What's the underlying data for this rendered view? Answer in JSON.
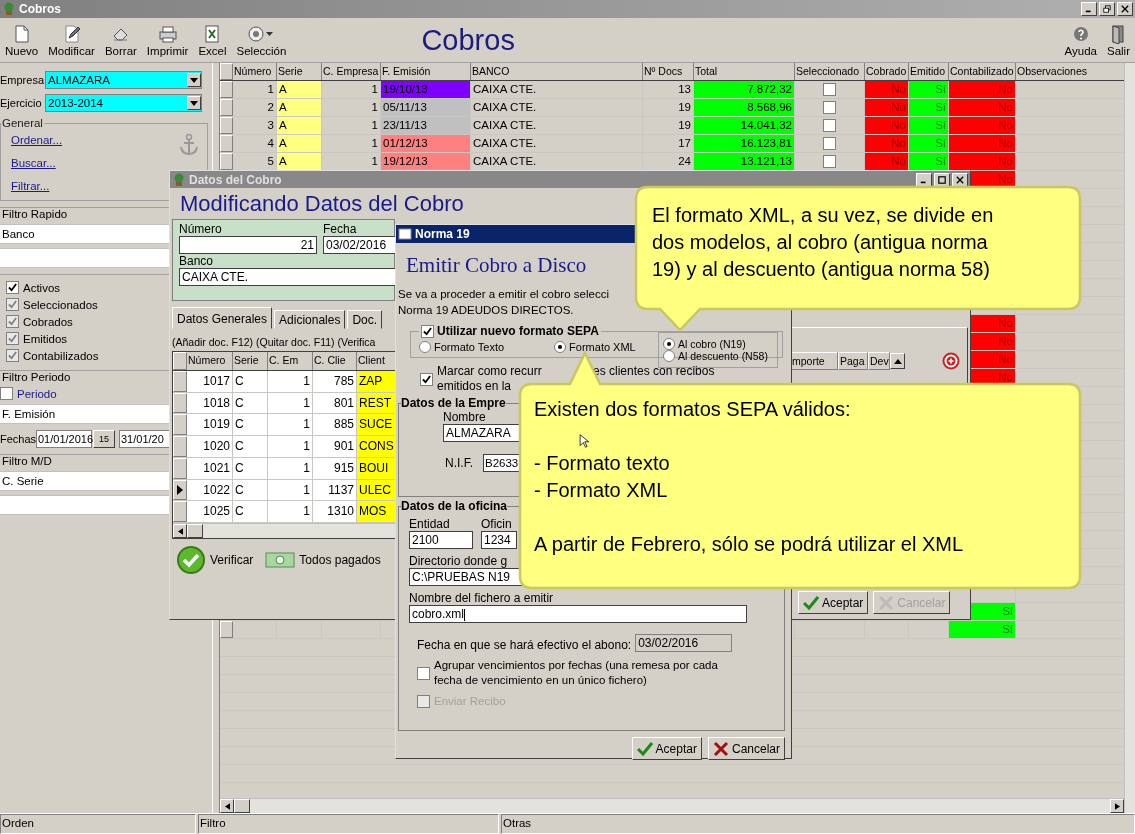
{
  "window": {
    "title": "Cobros"
  },
  "toolbar": {
    "buttons": [
      {
        "label": "Nuevo",
        "kind": "new"
      },
      {
        "label": "Modificar",
        "kind": "edit"
      },
      {
        "label": "Borrar",
        "kind": "delete"
      },
      {
        "label": "Imprimir",
        "kind": "print"
      },
      {
        "label": "Excel",
        "kind": "excel"
      },
      {
        "label": "Selección",
        "kind": "select"
      }
    ],
    "title": "Cobros",
    "right_buttons": [
      {
        "label": "Ayuda",
        "kind": "help"
      },
      {
        "label": "Salir",
        "kind": "exit"
      }
    ]
  },
  "sidebar": {
    "empresa": {
      "label": "Empresa",
      "value": "ALMAZARA"
    },
    "ejercicio": {
      "label": "Ejercicio",
      "value": "2013-2014"
    },
    "general": {
      "title": "General",
      "links": [
        "Ordenar...",
        "Buscar...",
        "Filtrar..."
      ]
    },
    "filtro_rapido": {
      "title": "Filtro Rapido",
      "field": "Banco"
    },
    "checks": [
      {
        "label": "Activos",
        "checked": true,
        "disabled": false
      },
      {
        "label": "Seleccionados",
        "checked": true,
        "disabled": true
      },
      {
        "label": "Cobrados",
        "checked": true,
        "disabled": true
      },
      {
        "label": "Emitidos",
        "checked": true,
        "disabled": true
      },
      {
        "label": "Contabilizados",
        "checked": true,
        "disabled": true
      }
    ],
    "filtro_periodo": {
      "title": "Filtro Periodo",
      "periodo": {
        "label": "Periodo",
        "checked": false
      },
      "field": "F. Emisión",
      "fechas_label": "Fechas",
      "from": "01/01/2016",
      "calendar": "15",
      "to": "31/01/20"
    },
    "filtro_md": {
      "title": "Filtro M/D",
      "field": "C. Serie"
    }
  },
  "table": {
    "columns": [
      "Número",
      "Serie",
      "C. Empresa",
      "F. Emisión",
      "BANCO",
      "Nº Docs",
      "Total",
      "Seleccionado",
      "Cobrado",
      "Emitido",
      "Contabilizado",
      "Observaciones"
    ],
    "rows": [
      {
        "numero": "1",
        "serie": "A",
        "empresa": "1",
        "fecha": "19/10/13",
        "color": "#8000ff",
        "banco": "CAIXA CTE.",
        "docs": "13",
        "total": "7.872,32",
        "seleccionado": false,
        "cobrado": {
          "text": "No",
          "on": false
        },
        "emitido": {
          "text": "Sí",
          "on": true
        },
        "contabilizado": {
          "text": "No",
          "on": false
        }
      },
      {
        "numero": "2",
        "serie": "A",
        "empresa": "1",
        "fecha": "05/11/13",
        "color": "#c0c0c0",
        "banco": "CAIXA CTE.",
        "docs": "19",
        "total": "8.568,96",
        "seleccionado": false,
        "cobrado": {
          "text": "No",
          "on": false
        },
        "emitido": {
          "text": "Sí",
          "on": true
        },
        "contabilizado": {
          "text": "No",
          "on": false
        }
      },
      {
        "numero": "3",
        "serie": "A",
        "empresa": "1",
        "fecha": "23/11/13",
        "color": "#c0c0c0",
        "banco": "CAIXA CTE.",
        "docs": "19",
        "total": "14.041,32",
        "seleccionado": false,
        "cobrado": {
          "text": "No",
          "on": false
        },
        "emitido": {
          "text": "Sí",
          "on": true
        },
        "contabilizado": {
          "text": "No",
          "on": false
        }
      },
      {
        "numero": "4",
        "serie": "A",
        "empresa": "1",
        "fecha": "01/12/13",
        "color": "#ff8080",
        "banco": "CAIXA CTE.",
        "docs": "17",
        "total": "16.123,81",
        "seleccionado": false,
        "cobrado": {
          "text": "No",
          "on": false
        },
        "emitido": {
          "text": "Sí",
          "on": true
        },
        "contabilizado": {
          "text": "No",
          "on": false
        }
      },
      {
        "numero": "5",
        "serie": "A",
        "empresa": "1",
        "fecha": "19/12/13",
        "color": "#ff8080",
        "banco": "CAIXA CTE.",
        "docs": "24",
        "total": "13.121,13",
        "seleccionado": false,
        "cobrado": {
          "text": "No",
          "on": false
        },
        "emitido": {
          "text": "Sí",
          "on": true
        },
        "contabilizado": {
          "text": "No",
          "on": false
        }
      },
      {
        "contabilizado": {
          "text": "No",
          "on": false
        }
      },
      {},
      {},
      {},
      {},
      {},
      {},
      {},
      {
        "contabilizado": {
          "text": "No",
          "on": false
        }
      },
      {
        "contabilizado": {
          "text": "No",
          "on": false
        }
      },
      {
        "contabilizado": {
          "text": "No",
          "on": false
        }
      },
      {
        "contabilizado": {
          "text": "No",
          "on": false
        }
      },
      {},
      {},
      {},
      {},
      {},
      {},
      {},
      {},
      {},
      {},
      {},
      {},
      {
        "contabilizado": {
          "text": "Sí",
          "on": true
        }
      },
      {
        "contabilizado": {
          "text": "Sí",
          "on": true
        }
      }
    ]
  },
  "datos_cobro": {
    "title": "Datos del Cobro",
    "heading": "Modificando Datos del Cobro",
    "numero": {
      "label": "Número",
      "value": "21"
    },
    "fecha": {
      "label": "Fecha",
      "value": "03/02/2016"
    },
    "banco": {
      "label": "Banco",
      "value": "CAIXA CTE."
    },
    "tabs": [
      {
        "label": "Datos Generales",
        "selected": true
      },
      {
        "label": "Adicionales",
        "selected": false
      },
      {
        "label": "Doc.",
        "selected": false
      }
    ],
    "hint": "(Añadir doc. F12)  (Quitar doc. F11)  (Verifica",
    "columns": [
      "Número",
      "Serie",
      "C. Em",
      "C. Clie",
      "Client"
    ],
    "rows": [
      {
        "numero": "1017",
        "serie": "C",
        "empresa": "1",
        "cliente": "785",
        "nombre": "ZAP",
        "current": false
      },
      {
        "numero": "1018",
        "serie": "C",
        "empresa": "1",
        "cliente": "801",
        "nombre": "REST",
        "current": false
      },
      {
        "numero": "1019",
        "serie": "C",
        "empresa": "1",
        "cliente": "885",
        "nombre": "SUCE",
        "current": false
      },
      {
        "numero": "1020",
        "serie": "C",
        "empresa": "1",
        "cliente": "901",
        "nombre": "CONS",
        "current": false
      },
      {
        "numero": "1021",
        "serie": "C",
        "empresa": "1",
        "cliente": "915",
        "nombre": "BOUI",
        "current": false
      },
      {
        "numero": "1022",
        "serie": "C",
        "empresa": "1",
        "cliente": "1137",
        "nombre": "ULEC",
        "current": true
      },
      {
        "numero": "1025",
        "serie": "C",
        "empresa": "1",
        "cliente": "1310",
        "nombre": "MOS",
        "current": false
      }
    ],
    "verificar": "Verificar",
    "todos_pagados": "Todos pagados",
    "right_columns": [
      "mporte",
      "Paga",
      "Dev"
    ],
    "buttons": [
      {
        "label": "Aceptar",
        "kind": "ok",
        "disabled": false
      },
      {
        "label": "Cancelar",
        "kind": "cancel",
        "disabled": true
      }
    ]
  },
  "norma19": {
    "title": "Norma 19",
    "heading": "Emitir Cobro a Disco",
    "intro": [
      "Se va a proceder a emitir el cobro selecci",
      "Norma 19 ADEUDOS DIRECTOS."
    ],
    "sepa": {
      "label": "Utilizar nuevo formato SEPA",
      "checked": true,
      "formats": [
        {
          "label": "Formato Texto",
          "selected": false
        },
        {
          "label": "Formato XML",
          "selected": true
        }
      ],
      "models": [
        {
          "label": "Al cobro (N19)",
          "selected": true
        },
        {
          "label": "Al descuento (N58)",
          "selected": false
        }
      ]
    },
    "recurrentes": {
      "parts": [
        "Marcar como recurr",
        "es clientes con recibos",
        "emitidos en la"
      ],
      "checked": true
    },
    "empresa": {
      "title": "Datos de la Empre",
      "nombre_label": "Nombre",
      "nombre": "ALMAZARA",
      "nif_label": "N.I.F.",
      "nif": "B2633"
    },
    "oficina": {
      "title": "Datos de la oficina",
      "entidad_label": "Entidad",
      "entidad": "2100",
      "oficina_label": "Oficin",
      "oficina": "1234",
      "dir_label": "Directorio donde g",
      "dir": "C:\\PRUEBAS N19",
      "fichero_label": "Nombre del fichero a emitir",
      "fichero": "cobro.xml",
      "fecha_label": "Fecha en que se hará efectivo el abono:",
      "fecha": "03/02/2016",
      "agrupar": {
        "label": "Agrupar vencimientos por fechas (una remesa por cada fecha de vencimiento en un único fichero)",
        "checked": false,
        "disabled": false
      },
      "enviar": {
        "label": "Enviar Recibo",
        "checked": false,
        "disabled": true
      }
    },
    "buttons": [
      {
        "label": "Aceptar",
        "kind": "ok",
        "disabled": false
      },
      {
        "label": "Cancelar",
        "kind": "cancel",
        "disabled": false
      }
    ]
  },
  "callouts": [
    {
      "paragraphs": [
        [
          "El formato XML, a su vez, se divide en",
          "dos modelos, al cobro (antigua norma",
          "19) y al descuento (antigua norma 58)"
        ]
      ]
    },
    {
      "paragraphs": [
        [
          "Existen dos formatos SEPA válidos:"
        ],
        [
          "- Formato texto",
          "- Formato XML"
        ],
        [
          "A partir de Febrero, sólo se podrá utilizar el XML"
        ]
      ]
    }
  ],
  "status_bar": [
    "Orden",
    "Filtro",
    "Otras"
  ]
}
